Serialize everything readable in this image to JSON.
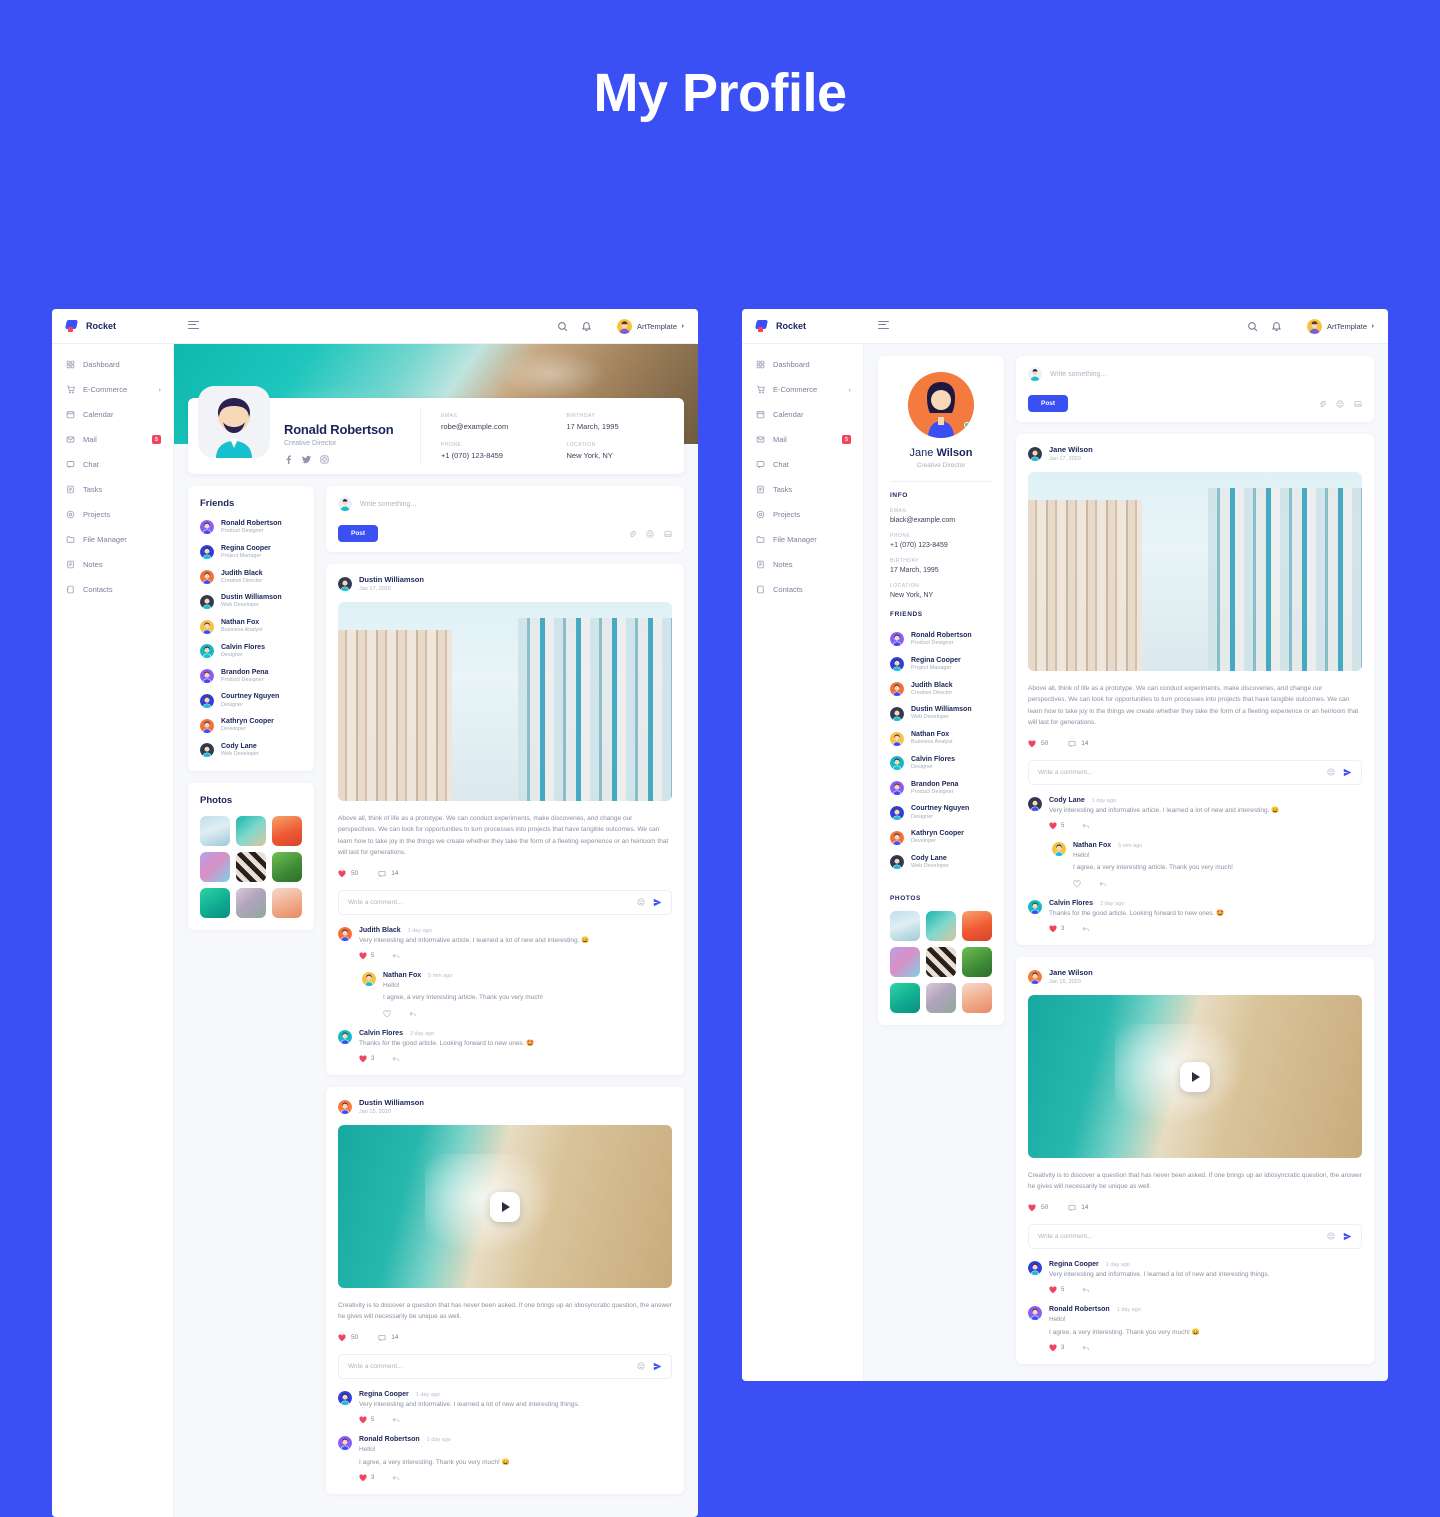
{
  "page": {
    "title": "My Profile",
    "bg_color": "#3a50f5",
    "accent": "#3a50f5",
    "danger": "#f2445c"
  },
  "brand": {
    "name": "Rocket",
    "icon": "rocket-icon"
  },
  "sidebar": {
    "items": [
      {
        "label": "Dashboard",
        "icon": "grid-icon"
      },
      {
        "label": "E-Commerce",
        "icon": "cart-icon",
        "caret": true
      },
      {
        "label": "Calendar",
        "icon": "calendar-icon"
      },
      {
        "label": "Mail",
        "icon": "mail-icon",
        "badge": "5"
      },
      {
        "label": "Chat",
        "icon": "chat-icon"
      },
      {
        "label": "Tasks",
        "icon": "tasks-icon"
      },
      {
        "label": "Projects",
        "icon": "projects-icon"
      },
      {
        "label": "File Manager",
        "icon": "folder-icon"
      },
      {
        "label": "Notes",
        "icon": "notes-icon"
      },
      {
        "label": "Contacts",
        "icon": "contacts-icon"
      }
    ]
  },
  "topbar": {
    "menu_icon": "hamburger-icon",
    "search_icon": "search-icon",
    "bell_icon": "bell-icon",
    "user": "ArtTemplate",
    "avatar": "user-avatar"
  },
  "left": {
    "profile": {
      "name": "Ronald Robertson",
      "role": "Creative Director",
      "socials": [
        "facebook-icon",
        "twitter-icon",
        "instagram-icon"
      ],
      "info": [
        {
          "key": "EMAIL",
          "value": "robe@example.com"
        },
        {
          "key": "BIRTHDAY",
          "value": "17 March, 1995"
        },
        {
          "key": "PHONE",
          "value": "+1 (070) 123-8459"
        },
        {
          "key": "LOCATION",
          "value": "New York, NY"
        }
      ]
    },
    "friends_title": "Friends",
    "photos_title": "Photos"
  },
  "right": {
    "profile": {
      "name_first": "Jane ",
      "name_last": "Wilson",
      "role": "Creative Director",
      "info_title": "INFO",
      "info": [
        {
          "key": "EMAIL",
          "value": "black@example.com"
        },
        {
          "key": "PHONE",
          "value": "+1 (070) 123-8459"
        },
        {
          "key": "BIRTHDAY",
          "value": "17 March, 1995"
        },
        {
          "key": "LOCATION",
          "value": "New York, NY"
        }
      ]
    },
    "friends_title": "FRIENDS",
    "photos_title": "PHOTOS"
  },
  "friends": [
    {
      "name": "Ronald Robertson",
      "role": "Product Designer",
      "color": "#8b5cf6"
    },
    {
      "name": "Regina Cooper",
      "role": "Project Manager",
      "color": "#2f3fd8"
    },
    {
      "name": "Judith Black",
      "role": "Creative Director",
      "color": "#f4703a"
    },
    {
      "name": "Dustin Williamson",
      "role": "Web Developer",
      "color": "#2f3b52"
    },
    {
      "name": "Nathan Fox",
      "role": "Business Analyst",
      "color": "#f5c242"
    },
    {
      "name": "Calvin Flores",
      "role": "Designer",
      "color": "#15b8c4"
    },
    {
      "name": "Brandon Pena",
      "role": "Product Designer",
      "color": "#8b5cf6"
    },
    {
      "name": "Courtney Nguyen",
      "role": "Designer",
      "color": "#2f3fd8"
    },
    {
      "name": "Kathryn Cooper",
      "role": "Developer",
      "color": "#f4703a"
    },
    {
      "name": "Cody Lane",
      "role": "Web Developer",
      "color": "#2f3b52"
    }
  ],
  "photos": [
    {
      "name": "city-photo",
      "css": "linear-gradient(160deg,#bfe0ea,#dfeef3 45%,#9fc9d8)"
    },
    {
      "name": "wave-photo",
      "css": "linear-gradient(140deg,#17b6ae,#7fd8cd 50%,#d9c79c)"
    },
    {
      "name": "mountain-photo",
      "css": "linear-gradient(160deg,#f7a36b,#ef5a34 55%,#d8442a)"
    },
    {
      "name": "abstract-photo",
      "css": "linear-gradient(135deg,#b8a0e8,#d98fc4 45%,#7fd0e8)"
    },
    {
      "name": "pattern-photo",
      "css": "repeating-linear-gradient(45deg,#2a1f1a 0 5px,#e8e0d4 5px 10px)"
    },
    {
      "name": "leaf-photo",
      "css": "linear-gradient(150deg,#6fbf55,#3e8a36 60%,#2c6d2a)"
    },
    {
      "name": "gradient-photo",
      "css": "linear-gradient(150deg,#2fd3a6,#0fa98f 60%,#0c8f7e)"
    },
    {
      "name": "texture-photo",
      "css": "linear-gradient(140deg,#dcc8d8,#b0a4bb 45%,#8fa8a0)"
    },
    {
      "name": "desert-photo",
      "css": "linear-gradient(160deg,#f6d9cb,#efa887 60%,#e68a63)"
    }
  ],
  "composer": {
    "placeholder": "Write something...",
    "post_label": "Post",
    "actions": [
      "attach-icon",
      "emoji-icon",
      "image-icon"
    ]
  },
  "comment_box": {
    "placeholder": "Write a comment...",
    "emoji_icon": "emoji-icon",
    "send_icon": "send-icon"
  },
  "posts_left": [
    {
      "author": "Dustin Williamson",
      "date": "Jan 17, 2020",
      "media": "city-image",
      "text": "Above all, think of life as a prototype. We can conduct experiments, make discoveries, and change our perspectives. We can look for opportunities to turn processes into projects that have tangible outcomes. We can learn how to take joy in the things we create whether they take the form of a fleeting experience or an heirloom that will last for generations.",
      "likes": "50",
      "comments": "14",
      "comment_list": [
        {
          "name": "Judith Black",
          "time": "1 day ago",
          "text": "Very interesting and informative article. I learned a lot of new and interesting. 😄",
          "likes": "5",
          "reply": false,
          "avatar_color": "#f4703a"
        },
        {
          "name": "Nathan Fox",
          "time": "5 min ago",
          "text": "Hello!\nI agree, a very interesting article. Thank you very much!",
          "likes": "",
          "reply": true,
          "avatar_color": "#f5c242"
        },
        {
          "name": "Calvin Flores",
          "time": "2 day ago",
          "text": "Thanks for the good article. Looking forward to new ones. 🤩",
          "likes": "3",
          "reply": false,
          "avatar_color": "#15b8c4"
        }
      ]
    },
    {
      "author": "Dustin Williamson",
      "date": "Jan 15, 2020",
      "media": "beach-video",
      "text": "Creativity is to discover a question that has never been asked. If one brings up an idiosyncratic question, the answer he gives will necessarily be unique as well.",
      "likes": "50",
      "comments": "14",
      "comment_list": [
        {
          "name": "Regina Cooper",
          "time": "1 day ago",
          "text": "Very interesting and informative. I learned a lot of new and interesting things.",
          "likes": "5",
          "reply": false,
          "avatar_color": "#2f3fd8"
        },
        {
          "name": "Ronald Robertson",
          "time": "1 day ago",
          "text": "Hello!\nI agree, a very interesting. Thank you very much! 😄",
          "likes": "3",
          "reply": false,
          "avatar_color": "#8b5cf6"
        }
      ]
    }
  ],
  "posts_right": [
    {
      "author": "Jane Wilson",
      "date": "Jan 17, 2020",
      "media": "city-image",
      "text": "Above all, think of life as a prototype. We can conduct experiments, make discoveries, and change our perspectives. We can look for opportunities to turn processes into projects that have tangible outcomes. We can learn how to take joy in the things we create whether they take the form of a fleeting experience or an heirloom that will last for generations.",
      "likes": "50",
      "comments": "14",
      "comment_list": [
        {
          "name": "Cody Lane",
          "time": "1 day ago",
          "text": "Very interesting and informative article. I learned a lot of new and interesting. 😄",
          "likes": "5",
          "reply": false,
          "avatar_color": "#2f3b52"
        },
        {
          "name": "Nathan Fox",
          "time": "5 min ago",
          "text": "Hello!\nI agree, a very interesting article. Thank you very much!",
          "likes": "",
          "reply": true,
          "avatar_color": "#f5c242"
        },
        {
          "name": "Calvin Flores",
          "time": "2 day ago",
          "text": "Thanks for the good article. Looking forward to new ones. 🤩",
          "likes": "3",
          "reply": false,
          "avatar_color": "#15b8c4"
        }
      ]
    },
    {
      "author": "Jane Wilson",
      "date": "Jan 15, 2020",
      "media": "beach-video",
      "text": "Creativity is to discover a question that has never been asked. If one brings up an idiosyncratic question, the answer he gives will necessarily be unique as well.",
      "likes": "50",
      "comments": "14",
      "comment_list": [
        {
          "name": "Regina Cooper",
          "time": "1 day ago",
          "text": "Very interesting and informative. I learned a lot of new and interesting things.",
          "likes": "5",
          "reply": false,
          "avatar_color": "#2f3fd8"
        },
        {
          "name": "Ronald Robertson",
          "time": "1 day ago",
          "text": "Hello!\nI agree, a very interesting. Thank you very much! 😄",
          "likes": "3",
          "reply": false,
          "avatar_color": "#8b5cf6"
        }
      ]
    }
  ]
}
